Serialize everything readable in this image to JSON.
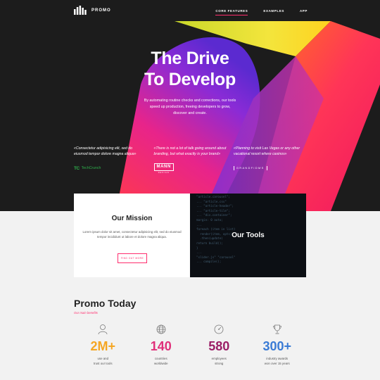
{
  "nav": {
    "brand": "PROMO",
    "links": [
      {
        "label": "CORE FEATURES",
        "active": true
      },
      {
        "label": "EXAMPLES",
        "active": false
      },
      {
        "label": "APP",
        "active": false
      }
    ]
  },
  "hero": {
    "title_line1": "The Drive",
    "title_line2": "To Develop",
    "subtitle": "By automating routine checks and corrections, our tools speed up production, freeing developers to grow, discover and create."
  },
  "testimonials": [
    {
      "quote": "«Consectetur adipisicing elit, sed do eiusmod tempor dolore magna aliqua»",
      "logo": "TechCrunch",
      "logo_mark": "TC"
    },
    {
      "quote": "«There is not a lot of talk going around about branding, but what exactly is your brand»",
      "logo": "MANN",
      "logo_sub": "DESIGN"
    },
    {
      "quote": "«Planning to visit Las Vegas or any other vacational resort where casinos»",
      "logo": "GRANDFIDMS"
    }
  ],
  "mission": {
    "title": "Our Mission",
    "text": "Lorem ipsum dolor sit amet, consectetur adipisicing elit, sed do eiusmod tempor incididunt ut labore et dolore magna aliqua.",
    "button": "FIND OUT MORE"
  },
  "tools": {
    "title": "Our Tools"
  },
  "promo": {
    "title": "Promo Today",
    "subtitle": "Our main benefits"
  },
  "stats": [
    {
      "value": "2M+",
      "line1": "use and",
      "line2": "trust our tools",
      "color": "#f5a623",
      "icon": "user-icon"
    },
    {
      "value": "140",
      "line1": "countries",
      "line2": "worldwide",
      "color": "#e0307a",
      "icon": "globe-icon"
    },
    {
      "value": "580",
      "line1": "employees",
      "line2": "strong",
      "color": "#9b1e66",
      "icon": "gauge-icon"
    },
    {
      "value": "300+",
      "line1": "industry awards",
      "line2": "won over 15 years",
      "color": "#3a7bd5",
      "icon": "trophy-icon"
    }
  ],
  "colors": {
    "accent": "#ff2d6e",
    "hero_bg": "#1c1c1c"
  }
}
